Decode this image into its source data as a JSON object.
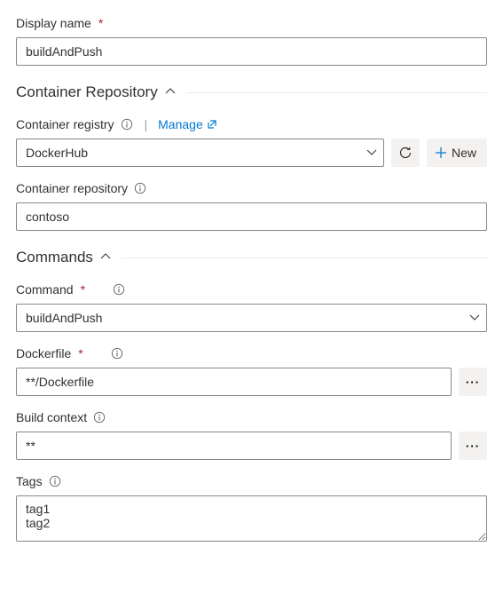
{
  "displayName": {
    "label": "Display name",
    "value": "buildAndPush"
  },
  "sections": {
    "containerRepository": "Container Repository",
    "commands": "Commands"
  },
  "containerRegistry": {
    "label": "Container registry",
    "manageLink": "Manage",
    "value": "DockerHub",
    "newButton": "New"
  },
  "containerRepository": {
    "label": "Container repository",
    "value": "contoso"
  },
  "command": {
    "label": "Command",
    "value": "buildAndPush"
  },
  "dockerfile": {
    "label": "Dockerfile",
    "value": "**/Dockerfile"
  },
  "buildContext": {
    "label": "Build context",
    "value": "**"
  },
  "tags": {
    "label": "Tags",
    "value": "tag1\ntag2"
  }
}
